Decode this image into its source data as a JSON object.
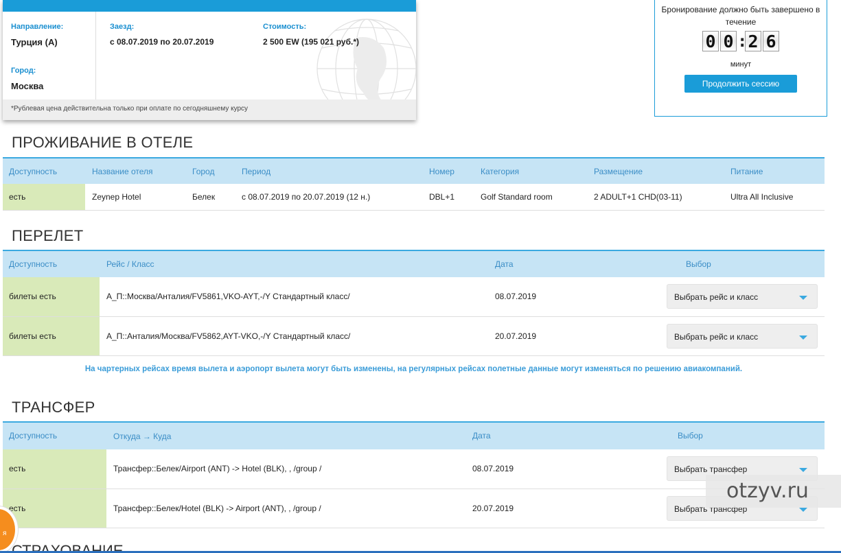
{
  "summary": {
    "direction_label": "Направление:",
    "direction_value": "Турция (А)",
    "city_label": "Город:",
    "city_value": "Москва",
    "checkin_label": "Заезд:",
    "checkin_value": "с 08.07.2019 по 20.07.2019",
    "cost_label": "Стоимость:",
    "cost_value": "2 500 EW (195 021 руб.*)",
    "footnote": "*Рублевая цена действительна только при оплате по сегодняшнему курсу"
  },
  "timer": {
    "text": "Бронирование должно быть завершено в течение",
    "digits": [
      "0",
      "0",
      "2",
      "6"
    ],
    "separator": ":",
    "unit": "минут",
    "continue_label": "Продолжить сессию"
  },
  "hotel": {
    "title": "ПРОЖИВАНИЕ В ОТЕЛЕ",
    "headers": [
      "Доступность",
      "Название отеля",
      "Город",
      "Период",
      "Номер",
      "Категория",
      "Размещение",
      "Питание"
    ],
    "row": {
      "availability": "есть",
      "name": "Zeynep Hotel",
      "city": "Белек",
      "period": "с 08.07.2019 по 20.07.2019 (12 н.)",
      "room": "DBL+1",
      "category": "Golf Standard room",
      "placement": "2 ADULT+1 CHD(03-11)",
      "meal": "Ultra All Inclusive"
    }
  },
  "flight": {
    "title": "ПЕРЕЛЕТ",
    "headers": [
      "Доступность",
      "Рейс / Класс",
      "Дата",
      "Выбор"
    ],
    "rows": [
      {
        "availability": "билеты есть",
        "route": "А_П::Москва/Анталия/FV5861,VKO-AYT,-/Y Стандартный класс/",
        "date": "08.07.2019",
        "select": "Выбрать рейс и класс"
      },
      {
        "availability": "билеты есть",
        "route": "А_П::Анталия/Москва/FV5862,AYT-VKO,-/Y Стандартный класс/",
        "date": "20.07.2019",
        "select": "Выбрать рейс и класс"
      }
    ],
    "notice": "На чартерных рейсах время вылета и аэропорт вылета могут быть изменены, на регулярных рейсах полетные данные могут изменяться по решению авиакомпаний."
  },
  "transfer": {
    "title": "ТРАНСФЕР",
    "headers": [
      "Доступность",
      "Откуда → Куда",
      "Дата",
      "Выбор"
    ],
    "rows": [
      {
        "availability": "есть",
        "route": "Трансфер::Белек/Airport (ANT) -> Hotel (BLK), , /group /",
        "date": "08.07.2019",
        "select": "Выбрать трансфер"
      },
      {
        "availability": "есть",
        "route": "Трансфер::Белек/Hotel (BLK) -> Airport (ANT), , /group /",
        "date": "20.07.2019",
        "select": "Выбрать трансфер"
      }
    ]
  },
  "insurance": {
    "title": "СТРАХОВАНИЕ"
  },
  "watermark": "otzyv.ru",
  "badge_text": "я",
  "colors": {
    "accent": "#1a9cd8",
    "header_bg": "#c6e4f5",
    "avail_bg": "#d9eab9",
    "header_text": "#3a8dc6"
  }
}
